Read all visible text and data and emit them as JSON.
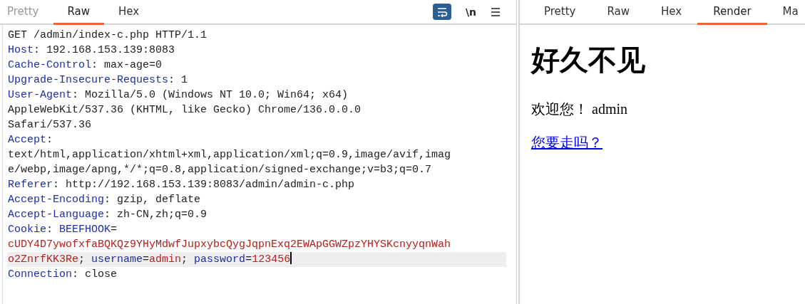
{
  "request_pane": {
    "tabs": [
      {
        "label": "Pretty",
        "selected": false
      },
      {
        "label": "Raw",
        "selected": true
      },
      {
        "label": "Hex",
        "selected": false
      }
    ],
    "toolbar": {
      "wrap_on": true,
      "newline_label": "\\n"
    },
    "lines": [
      {
        "highlighted": false,
        "segments": [
          {
            "kind": "plain",
            "text": "GET /admin/index-c.php HTTP/1.1"
          }
        ]
      },
      {
        "highlighted": false,
        "segments": [
          {
            "kind": "name",
            "text": "Host"
          },
          {
            "kind": "plain",
            "text": ": 192.168.153.139:8083"
          }
        ]
      },
      {
        "highlighted": false,
        "segments": [
          {
            "kind": "name",
            "text": "Cache-Control"
          },
          {
            "kind": "plain",
            "text": ": max-age=0"
          }
        ]
      },
      {
        "highlighted": false,
        "segments": [
          {
            "kind": "name",
            "text": "Upgrade-Insecure-Requests"
          },
          {
            "kind": "plain",
            "text": ": 1"
          }
        ]
      },
      {
        "highlighted": false,
        "segments": [
          {
            "kind": "name",
            "text": "User-Agent"
          },
          {
            "kind": "plain",
            "text": ": Mozilla/5.0 (Windows NT 10.0; Win64; x64)"
          }
        ]
      },
      {
        "highlighted": false,
        "segments": [
          {
            "kind": "plain",
            "text": "AppleWebKit/537.36 (KHTML, like Gecko) Chrome/136.0.0.0"
          }
        ]
      },
      {
        "highlighted": false,
        "segments": [
          {
            "kind": "plain",
            "text": "Safari/537.36"
          }
        ]
      },
      {
        "highlighted": false,
        "segments": [
          {
            "kind": "name",
            "text": "Accept"
          },
          {
            "kind": "plain",
            "text": ":"
          }
        ]
      },
      {
        "highlighted": false,
        "segments": [
          {
            "kind": "plain",
            "text": "text/html,application/xhtml+xml,application/xml;q=0.9,image/avif,imag"
          }
        ]
      },
      {
        "highlighted": false,
        "segments": [
          {
            "kind": "plain",
            "text": "e/webp,image/apng,*/*;q=0.8,application/signed-exchange;v=b3;q=0.7"
          }
        ]
      },
      {
        "highlighted": false,
        "segments": [
          {
            "kind": "name",
            "text": "Referer"
          },
          {
            "kind": "plain",
            "text": ": http://192.168.153.139:8083/admin/admin-c.php"
          }
        ]
      },
      {
        "highlighted": false,
        "segments": [
          {
            "kind": "name",
            "text": "Accept-Encoding"
          },
          {
            "kind": "plain",
            "text": ": gzip, deflate"
          }
        ]
      },
      {
        "highlighted": false,
        "segments": [
          {
            "kind": "name",
            "text": "Accept-Language"
          },
          {
            "kind": "plain",
            "text": ": zh-CN,zh;q=0.9"
          }
        ]
      },
      {
        "highlighted": false,
        "segments": [
          {
            "kind": "name",
            "text": "Cookie"
          },
          {
            "kind": "plain",
            "text": ": "
          },
          {
            "kind": "name",
            "text": "BEEFHOOK"
          },
          {
            "kind": "plain",
            "text": "="
          }
        ]
      },
      {
        "highlighted": false,
        "segments": [
          {
            "kind": "value",
            "text": "cUDY4D7ywofxfaBQKQz9YHyMdwfJupxybcQygJqpnExq2EWApGGWZpzYHYSKcnyyqnWah"
          }
        ]
      },
      {
        "highlighted": true,
        "segments": [
          {
            "kind": "value",
            "text": "o2ZnrfKK3Re"
          },
          {
            "kind": "plain",
            "text": "; "
          },
          {
            "kind": "name",
            "text": "username"
          },
          {
            "kind": "plain",
            "text": "="
          },
          {
            "kind": "value",
            "text": "admin"
          },
          {
            "kind": "plain",
            "text": "; "
          },
          {
            "kind": "name",
            "text": "password"
          },
          {
            "kind": "plain",
            "text": "="
          },
          {
            "kind": "value",
            "text": "123456"
          }
        ]
      },
      {
        "highlighted": false,
        "segments": [
          {
            "kind": "name",
            "text": "Connection"
          },
          {
            "kind": "plain",
            "text": ": close"
          }
        ]
      }
    ]
  },
  "response_pane": {
    "tabs": [
      {
        "label": "Pretty",
        "selected": false
      },
      {
        "label": "Raw",
        "selected": false
      },
      {
        "label": "Hex",
        "selected": false
      },
      {
        "label": "Render",
        "selected": true
      },
      {
        "label": "Ma",
        "selected": false
      }
    ],
    "render": {
      "heading": "好久不见",
      "welcome": "欢迎您！",
      "username": "admin",
      "link": "您要走吗？"
    }
  }
}
